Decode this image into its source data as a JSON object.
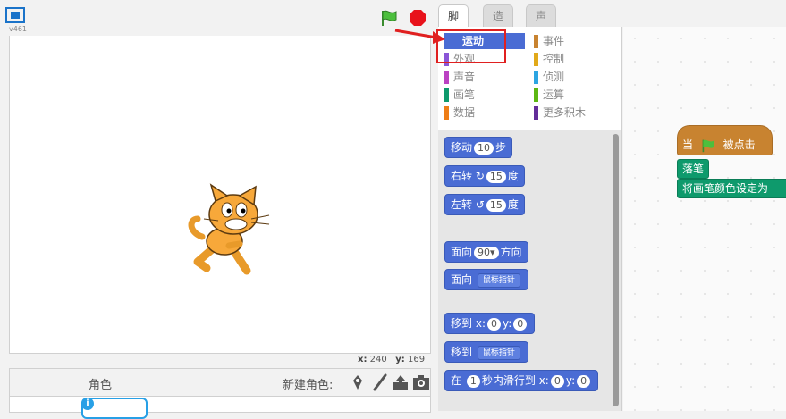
{
  "stage": {
    "version": "v461",
    "mouse_x_label": "x:",
    "mouse_x": "240",
    "mouse_y_label": "y:",
    "mouse_y": "169"
  },
  "sprites": {
    "label": "角色",
    "new_sprite_label": "新建角色:"
  },
  "tabs": [
    {
      "label": "脚本",
      "active": true
    },
    {
      "label": "造型",
      "active": false
    },
    {
      "label": "声音",
      "active": false
    }
  ],
  "categories": [
    {
      "label": "运动",
      "color": "#4a6cd4",
      "selected": true
    },
    {
      "label": "外观",
      "color": "#8a55d7"
    },
    {
      "label": "声音",
      "color": "#bb42c3"
    },
    {
      "label": "画笔",
      "color": "#0e9a6c"
    },
    {
      "label": "数据",
      "color": "#ee7d16"
    },
    {
      "label": "事件",
      "color": "#c88330"
    },
    {
      "label": "控制",
      "color": "#e1a91a"
    },
    {
      "label": "侦测",
      "color": "#2ca5e2"
    },
    {
      "label": "运算",
      "color": "#5cb712"
    },
    {
      "label": "更多积木",
      "color": "#632d99"
    }
  ],
  "blocks": {
    "move": {
      "pre": "移动",
      "value": "10",
      "post": "步"
    },
    "turn_right": {
      "pre": "右转",
      "icon": "↻",
      "value": "15",
      "post": "度"
    },
    "turn_left": {
      "pre": "左转",
      "icon": "↺",
      "value": "15",
      "post": "度"
    },
    "point_dir": {
      "pre": "面向",
      "value": "90▾",
      "post": "方向"
    },
    "point_towards": {
      "pre": "面向",
      "menu": "鼠标指针"
    },
    "goto_xy": {
      "pre": "移到",
      "x_label": "x:",
      "x": "0",
      "y_label": "y:",
      "y": "0"
    },
    "goto": {
      "pre": "移到",
      "menu": "鼠标指针"
    },
    "glide": {
      "pre": "在",
      "secs": "1",
      "mid": "秒内滑行到",
      "x_label": "x:",
      "x": "0",
      "y_label": "y:",
      "y": "0"
    }
  },
  "script": {
    "hat_pre": "当",
    "hat_post": "被点击",
    "pen_down": "落笔",
    "set_pen_color": "将画笔颜色设定为"
  },
  "colors": {
    "motion": "#4a6cd4",
    "events": "#c88330",
    "pen": "#0e9a6c",
    "annotation": "#e02020"
  }
}
